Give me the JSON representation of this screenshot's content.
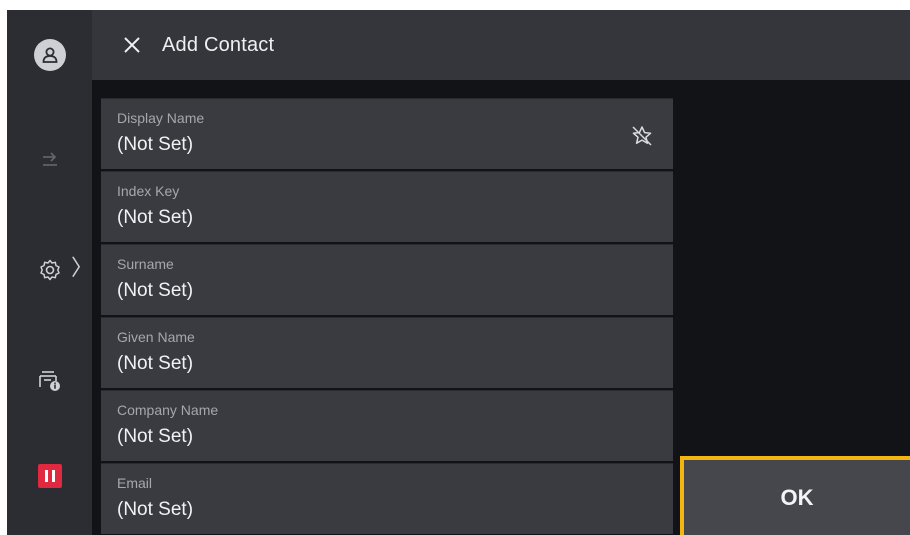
{
  "header": {
    "title": "Add Contact"
  },
  "fields": [
    {
      "label": "Display Name",
      "value": "(Not Set)"
    },
    {
      "label": "Index Key",
      "value": "(Not Set)"
    },
    {
      "label": "Surname",
      "value": "(Not Set)"
    },
    {
      "label": "Given Name",
      "value": "(Not Set)"
    },
    {
      "label": "Company Name",
      "value": "(Not Set)"
    },
    {
      "label": "Email",
      "value": "(Not Set)"
    }
  ],
  "ok_button": {
    "label": "OK"
  },
  "icons": {
    "avatar": "person-icon",
    "exit": "logout-icon",
    "settings": "gear-icon",
    "jobs": "printer-info-icon",
    "stop": "pause-icon",
    "close": "close-icon",
    "pin": "pin-off-icon"
  },
  "colors": {
    "highlight": "#f5b40f",
    "stop": "#e0283e"
  }
}
